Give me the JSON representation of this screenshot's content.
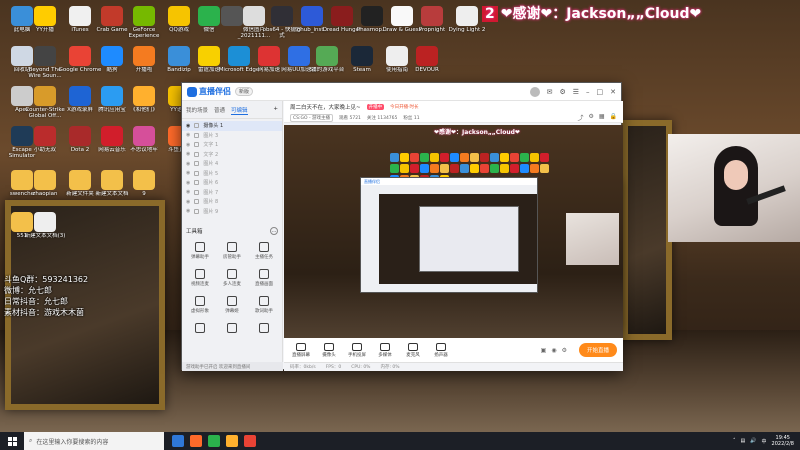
{
  "desktop": {
    "icons": [
      {
        "label": "此电脑",
        "color": "#3a8fd9"
      },
      {
        "label": "YY开播",
        "color": "#ffcc00"
      },
      {
        "label": "iTunes",
        "color": "#f0f0f0"
      },
      {
        "label": "Crab Game",
        "color": "#c23a2a"
      },
      {
        "label": "GeForce Experience",
        "color": "#76b900"
      },
      {
        "label": "QQ游戏",
        "color": "#f6c400"
      },
      {
        "label": "微信",
        "color": "#2bb24c"
      },
      {
        "label": "",
        "color": "#555"
      },
      {
        "label": "微信图片_2021111...",
        "color": "#ddd"
      },
      {
        "label": "obs64 - 快捷方式",
        "color": "#302f36"
      },
      {
        "label": "lghub_inst...",
        "color": "#2d5ad8"
      },
      {
        "label": "Dread Hunger",
        "color": "#8a1d1d"
      },
      {
        "label": "Phasmop...",
        "color": "#222"
      },
      {
        "label": "Draw & Guess",
        "color": "#f9f9f9"
      },
      {
        "label": "Propnight",
        "color": "#b83c3c"
      },
      {
        "label": "Dying Light 2",
        "color": "#eeeeee"
      },
      {
        "label": "回收站",
        "color": "#cfd8e4"
      },
      {
        "label": "Beyond The Wire Soun...",
        "color": "#444"
      },
      {
        "label": "Google Chrome",
        "color": "#e94335"
      },
      {
        "label": "酷狗",
        "color": "#1e8bff"
      },
      {
        "label": "开播啦",
        "color": "#f47b20"
      },
      {
        "label": "Bandizip",
        "color": "#3a8fd9"
      },
      {
        "label": "雷霆加速",
        "color": "#f8d000"
      },
      {
        "label": "Microsoft Edge",
        "color": "#1c8fd6"
      },
      {
        "label": "网易加速",
        "color": "#d33"
      },
      {
        "label": "网易UU加速器",
        "color": "#2f6fe4"
      },
      {
        "label": "SE的游戏平台",
        "color": "#5a5"
      },
      {
        "label": "Steam",
        "color": "#1b2838"
      },
      {
        "label": "使用指南",
        "color": "#eee"
      },
      {
        "label": "DEVOUR",
        "color": "#b22"
      },
      {
        "label": "Apex",
        "color": "#ccc"
      },
      {
        "label": "Counter-Strike Global Off...",
        "color": "#d89b2a"
      },
      {
        "label": "X游戏录屏",
        "color": "#1e64d4"
      },
      {
        "label": "腾讯应用宝",
        "color": "#2b9cf2"
      },
      {
        "label": "《和他们》",
        "color": "#ffb02e"
      },
      {
        "label": "YY语音",
        "color": "#f7c200"
      },
      {
        "label": "Escape Simulator",
        "color": "#1f3b57"
      },
      {
        "label": "小助无双",
        "color": "#ba2c2c"
      },
      {
        "label": "Dota 2",
        "color": "#a92a2a"
      },
      {
        "label": "网易云音乐",
        "color": "#d11e2b"
      },
      {
        "label": "不思议地牢",
        "color": "#d64f9a"
      },
      {
        "label": "斗鱼直播",
        "color": "#ff6a2a"
      },
      {
        "label": "swenche",
        "color": "#f3c04a"
      },
      {
        "label": "zhaopian",
        "color": "#f3c04a"
      },
      {
        "label": "新建文件夹",
        "color": "#f3c04a"
      },
      {
        "label": "新建文本文档",
        "color": "#f3c04a"
      },
      {
        "label": "9",
        "color": "#f3c04a"
      },
      {
        "label": "新建文本文档(3)",
        "color": "#eeeeee"
      },
      {
        "label": "551",
        "color": "#f3c04a"
      }
    ],
    "donate_number": "2",
    "donate_text": "❤感谢❤：Jackson„„Cloud❤",
    "info_lines": [
      "斗鱼Q群：593241362",
      "微博：允七郎",
      "日常抖音：允七郎",
      "素材抖音：游戏木木菌"
    ]
  },
  "app": {
    "brand": "直播伴侣",
    "version_badge": "新版",
    "left_tabs": [
      "我的场景",
      "普通",
      "可编辑"
    ],
    "active_tab": "可编辑",
    "scenes": [
      "摄像头 1",
      "图片 3",
      "文字 1",
      "文字 2",
      "图片 4",
      "图片 5",
      "图片 6",
      "图片 7",
      "图片 8",
      "图片 9"
    ],
    "toolbox_title": "工具箱",
    "tools": [
      "弹幕助手",
      "房管助手",
      "主播任务",
      "视频连麦",
      "多人连麦",
      "直播画面",
      "虚拟形象",
      "弹幕姬",
      "歌词助手",
      "",
      "",
      ""
    ],
    "left_status": "游戏助手已开启 欢迎来到直播间",
    "room_title": "周二白天不在，大家晚上见~",
    "room_tag": "开播中",
    "room_tag2": "今日开播·时长",
    "category": "CS:GO - 游戏主播",
    "stats": [
      "观看 5721",
      "关注 1134765",
      "粉丝 11"
    ],
    "mini_donate": "❤感谢❤：Jackson„„Cloud❤",
    "controls": [
      "直播屏幕",
      "摄像头",
      "手机投屏",
      "多媒体",
      "麦克风",
      "扬声器"
    ],
    "start_button": "开始直播",
    "status_bar": [
      "码率：0kb/s",
      "FPS：0",
      "CPU: 0%",
      "内存: 0%"
    ]
  },
  "taskbar": {
    "search_placeholder": "在这里输入你要搜索的内容",
    "time": "19:45",
    "date": "2022/2/8",
    "apps": [
      "#2f78d8",
      "#ff6a2a",
      "#2bb24c",
      "#ffb02e",
      "#e94335"
    ]
  }
}
